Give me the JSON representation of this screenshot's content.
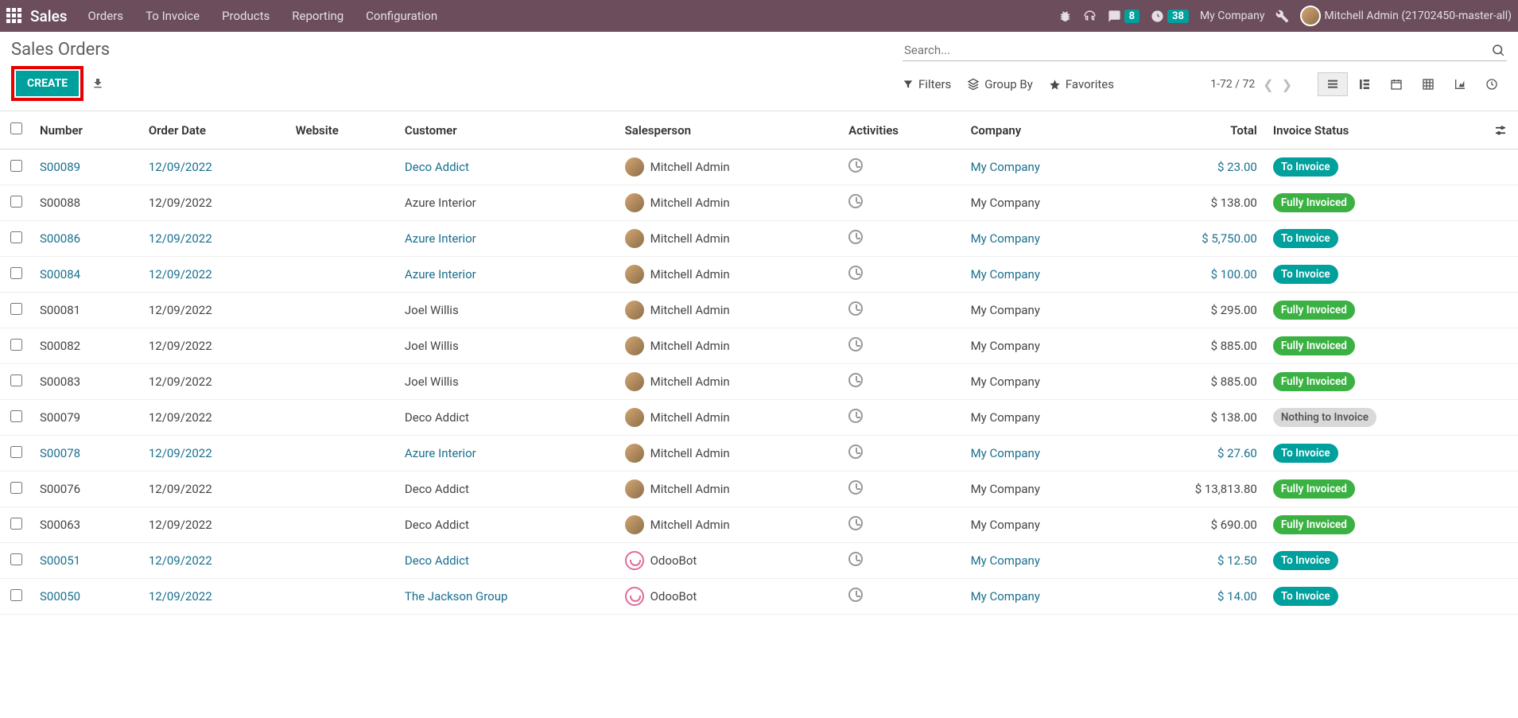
{
  "nav": {
    "app_name": "Sales",
    "items": [
      "Orders",
      "To Invoice",
      "Products",
      "Reporting",
      "Configuration"
    ],
    "chat_badge": "8",
    "activity_badge": "38",
    "company": "My Company",
    "user_name": "Mitchell Admin (21702450-master-all)"
  },
  "header": {
    "title": "Sales Orders",
    "create_label": "CREATE",
    "search_placeholder": "Search...",
    "filters_label": "Filters",
    "groupby_label": "Group By",
    "favorites_label": "Favorites",
    "pager_text": "1-72 / 72"
  },
  "columns": {
    "number": "Number",
    "order_date": "Order Date",
    "website": "Website",
    "customer": "Customer",
    "salesperson": "Salesperson",
    "activities": "Activities",
    "company": "Company",
    "total": "Total",
    "invoice_status": "Invoice Status"
  },
  "status_labels": {
    "to_invoice": "To Invoice",
    "fully_invoiced": "Fully Invoiced",
    "nothing": "Nothing to Invoice"
  },
  "rows": [
    {
      "number": "S00089",
      "date": "12/09/2022",
      "customer": "Deco Addict",
      "sp": "Mitchell Admin",
      "sp_avatar": "human",
      "company": "My Company",
      "total": "$ 23.00",
      "status": "to_invoice",
      "link": true
    },
    {
      "number": "S00088",
      "date": "12/09/2022",
      "customer": "Azure Interior",
      "sp": "Mitchell Admin",
      "sp_avatar": "human",
      "company": "My Company",
      "total": "$ 138.00",
      "status": "fully_invoiced",
      "link": false
    },
    {
      "number": "S00086",
      "date": "12/09/2022",
      "customer": "Azure Interior",
      "sp": "Mitchell Admin",
      "sp_avatar": "human",
      "company": "My Company",
      "total": "$ 5,750.00",
      "status": "to_invoice",
      "link": true
    },
    {
      "number": "S00084",
      "date": "12/09/2022",
      "customer": "Azure Interior",
      "sp": "Mitchell Admin",
      "sp_avatar": "human",
      "company": "My Company",
      "total": "$ 100.00",
      "status": "to_invoice",
      "link": true
    },
    {
      "number": "S00081",
      "date": "12/09/2022",
      "customer": "Joel Willis",
      "sp": "Mitchell Admin",
      "sp_avatar": "human",
      "company": "My Company",
      "total": "$ 295.00",
      "status": "fully_invoiced",
      "link": false
    },
    {
      "number": "S00082",
      "date": "12/09/2022",
      "customer": "Joel Willis",
      "sp": "Mitchell Admin",
      "sp_avatar": "human",
      "company": "My Company",
      "total": "$ 885.00",
      "status": "fully_invoiced",
      "link": false
    },
    {
      "number": "S00083",
      "date": "12/09/2022",
      "customer": "Joel Willis",
      "sp": "Mitchell Admin",
      "sp_avatar": "human",
      "company": "My Company",
      "total": "$ 885.00",
      "status": "fully_invoiced",
      "link": false
    },
    {
      "number": "S00079",
      "date": "12/09/2022",
      "customer": "Deco Addict",
      "sp": "Mitchell Admin",
      "sp_avatar": "human",
      "company": "My Company",
      "total": "$ 138.00",
      "status": "nothing",
      "link": false
    },
    {
      "number": "S00078",
      "date": "12/09/2022",
      "customer": "Azure Interior",
      "sp": "Mitchell Admin",
      "sp_avatar": "human",
      "company": "My Company",
      "total": "$ 27.60",
      "status": "to_invoice",
      "link": true
    },
    {
      "number": "S00076",
      "date": "12/09/2022",
      "customer": "Deco Addict",
      "sp": "Mitchell Admin",
      "sp_avatar": "human",
      "company": "My Company",
      "total": "$ 13,813.80",
      "status": "fully_invoiced",
      "link": false
    },
    {
      "number": "S00063",
      "date": "12/09/2022",
      "customer": "Deco Addict",
      "sp": "Mitchell Admin",
      "sp_avatar": "human",
      "company": "My Company",
      "total": "$ 690.00",
      "status": "fully_invoiced",
      "link": false
    },
    {
      "number": "S00051",
      "date": "12/09/2022",
      "customer": "Deco Addict",
      "sp": "OdooBot",
      "sp_avatar": "bot",
      "company": "My Company",
      "total": "$ 12.50",
      "status": "to_invoice",
      "link": true
    },
    {
      "number": "S00050",
      "date": "12/09/2022",
      "customer": "The Jackson Group",
      "sp": "OdooBot",
      "sp_avatar": "bot",
      "company": "My Company",
      "total": "$ 14.00",
      "status": "to_invoice",
      "link": true
    }
  ]
}
